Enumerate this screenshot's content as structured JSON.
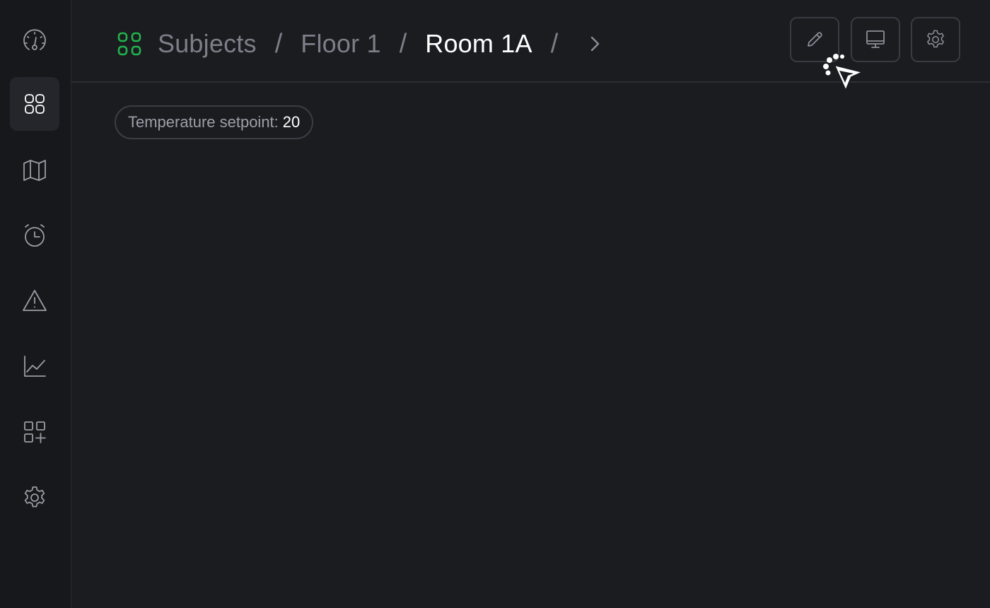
{
  "sidebar": {
    "items": [
      {
        "icon": "dashboard-gauge-icon",
        "active": false
      },
      {
        "icon": "subjects-grid-icon",
        "active": true
      },
      {
        "icon": "map-icon",
        "active": false
      },
      {
        "icon": "alarm-clock-icon",
        "active": false
      },
      {
        "icon": "warning-triangle-icon",
        "active": false
      },
      {
        "icon": "line-chart-icon",
        "active": false
      },
      {
        "icon": "add-widget-grid-icon",
        "active": false
      },
      {
        "icon": "gear-icon",
        "active": false
      }
    ]
  },
  "breadcrumb": {
    "icon": "subjects-grid-icon",
    "items": [
      "Subjects",
      "Floor 1",
      "Room 1A"
    ],
    "separator": "/"
  },
  "toolbar": {
    "buttons": [
      "pencil-icon",
      "monitor-icon",
      "gear-icon"
    ]
  },
  "main": {
    "setpoint": {
      "label": "Temperature setpoint:",
      "value": "20"
    }
  },
  "colors": {
    "background": "#1b1c20",
    "sidebar": "#17181b",
    "accent": "#22b24c",
    "muted_text": "#7d7e88"
  }
}
